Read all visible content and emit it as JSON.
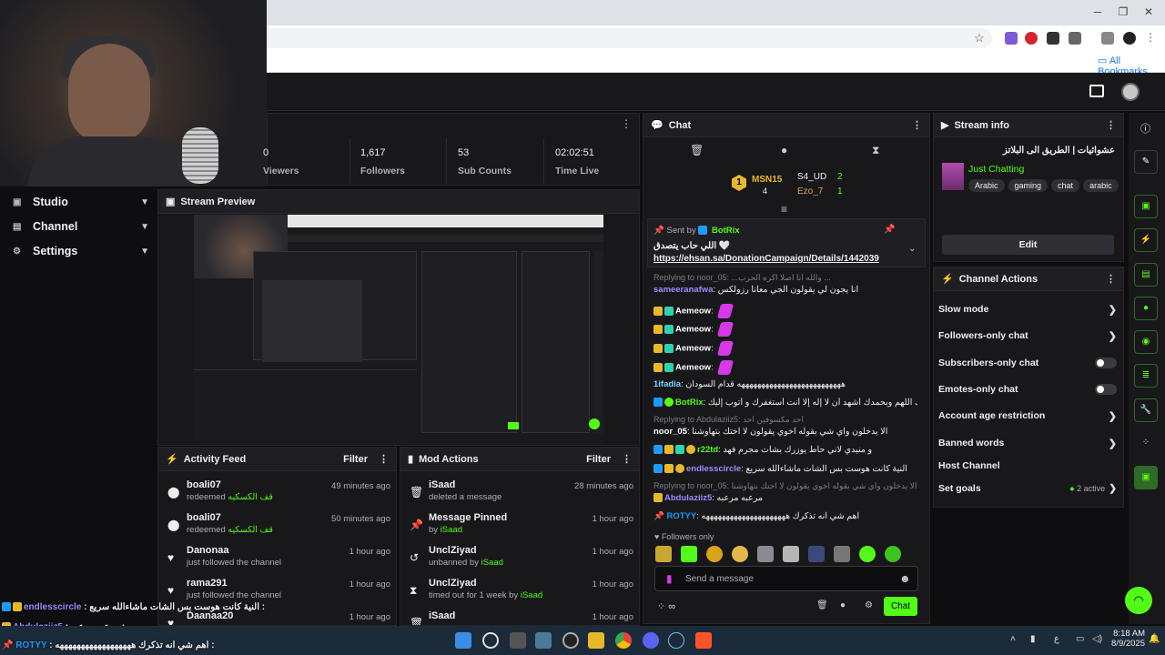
{
  "browser": {
    "all_bookmarks": "All Bookmarks",
    "controls": {
      "minimize": "─",
      "restore": "❐",
      "close": "✕"
    }
  },
  "nav": {
    "items": [
      {
        "label": "Studio",
        "icon": "studio-icon"
      },
      {
        "label": "Channel",
        "icon": "channel-icon"
      },
      {
        "label": "Settings",
        "icon": "gear-icon"
      }
    ]
  },
  "stats": [
    {
      "value": "0",
      "label": "Viewers"
    },
    {
      "value": "1,617",
      "label": "Followers"
    },
    {
      "value": "53",
      "label": "Sub Counts"
    },
    {
      "value": "02:02:51",
      "label": "Time Live"
    }
  ],
  "stream_preview": {
    "title": "Stream Preview"
  },
  "activity_feed": {
    "title": "Activity Feed",
    "filter": "Filter",
    "items": [
      {
        "name": "boali07",
        "action": "redeemed",
        "detail": "قف الكسكيه",
        "time": "49 minutes ago",
        "icon": "redeem-icon"
      },
      {
        "name": "boali07",
        "action": "redeemed",
        "detail": "قف الكسكيه",
        "time": "50 minutes ago",
        "icon": "redeem-icon"
      },
      {
        "name": "Danonaa",
        "action": "just followed the channel",
        "detail": "",
        "time": "1 hour ago",
        "icon": "heart-icon"
      },
      {
        "name": "rama291",
        "action": "just followed the channel",
        "detail": "",
        "time": "1 hour ago",
        "icon": "heart-icon"
      },
      {
        "name": "Daanaa20",
        "action": "",
        "detail": "",
        "time": "1 hour ago",
        "icon": "heart-icon"
      }
    ]
  },
  "mod_actions": {
    "title": "Mod Actions",
    "filter": "Filter",
    "items": [
      {
        "name": "iSaad",
        "action": "deleted a message",
        "by": "",
        "time": "28 minutes ago",
        "icon": "trash-icon"
      },
      {
        "name": "Message Pinned",
        "action": "by",
        "by": "iSaad",
        "time": "1 hour ago",
        "icon": "pin-icon"
      },
      {
        "name": "UnclZiyad",
        "action": "unbanned by",
        "by": "iSaad",
        "time": "1 hour ago",
        "icon": "undo-icon"
      },
      {
        "name": "UnclZiyad",
        "action": "timed out for 1 week by",
        "by": "iSaad",
        "time": "1 hour ago",
        "icon": "hourglass-icon"
      },
      {
        "name": "iSaad",
        "action": "",
        "by": "",
        "time": "1 hour ago",
        "icon": "trash-icon"
      }
    ]
  },
  "chat": {
    "title": "Chat",
    "leaders": [
      {
        "rank": "1",
        "name": "MSN15",
        "count": "4"
      },
      {
        "name": "S4_UD",
        "count": "2"
      },
      {
        "name": "Ezo_7",
        "count": "1"
      }
    ],
    "pinned": {
      "sent_by_label": "Sent by",
      "sent_by": "BotRix",
      "text": "اللي حاب يتصدق 🤍",
      "link": "https://ehsan.sa/DonationCampaign/Details/1442039"
    },
    "messages": [
      {
        "reply": "Replying to noor_05: ...والله انا اصلا اكره الحرب ...",
        "user": "sameeranafwa",
        "text": "انا يجون لي يقولون الجي معانا رزولكس"
      },
      {
        "user": "Aemeow",
        "text": "",
        "emote": true
      },
      {
        "user": "Aemeow",
        "text": "",
        "emote": true
      },
      {
        "user": "Aemeow",
        "text": "",
        "emote": true
      },
      {
        "user": "Aemeow",
        "text": "",
        "emote": true
      },
      {
        "user": "1ifadia",
        "text": "ههههههههههههههههههههههههههه قدام السودان"
      },
      {
        "user": "BotRix",
        "text": "سبحانك اللهم وبحمدك أشهد أن لا إله إلا أنت أستغفرك و أتوب إليك"
      },
      {
        "reply": "Replying to Abdulaziiz5: احد مكسوفين احد",
        "user": "noor_05",
        "text": "الا يدخلون واي شي بقوله اخوي يقولون لا اختك بتهاوشنا"
      },
      {
        "user": "r22td",
        "text": "و منيدي لاني حاط يوزرك بشات مجرم فهد"
      },
      {
        "user": "endlesscircle",
        "text": "النية كانت هوست بس الشات ماشاءالله سريع"
      },
      {
        "reply": "Replying to noor_05: الا يدخلون واي شي بقوله اخوي يقولون لا اختك بتهاوشنا",
        "user": "Abdulaziiz5",
        "text": "مرعبه مرعبه"
      },
      {
        "user": "ROTYY",
        "text": "اهم شي انه تذكرك هههههههههههههههههههههه"
      }
    ],
    "followers_only": "Followers only",
    "input_placeholder": "Send a message",
    "send_label": "Chat"
  },
  "stream_info": {
    "title": "Stream info",
    "stream_title": "عشوائيات | الطريق الى البلاتز",
    "category": "Just Chatting",
    "tags": [
      "Arabic",
      "gaming",
      "chat",
      "arabic"
    ],
    "edit_label": "Edit"
  },
  "channel_actions": {
    "title": "Channel Actions",
    "items": [
      {
        "label": "Slow mode",
        "kind": "chevron"
      },
      {
        "label": "Followers-only chat",
        "kind": "chevron"
      },
      {
        "label": "Subscribers-only chat",
        "kind": "toggle"
      },
      {
        "label": "Emotes-only chat",
        "kind": "toggle"
      },
      {
        "label": "Account age restriction",
        "kind": "chevron"
      },
      {
        "label": "Banned words",
        "kind": "chevron"
      },
      {
        "label": "Host Channel",
        "kind": "none"
      },
      {
        "label": "Set goals",
        "kind": "status",
        "status": "2 active"
      }
    ]
  },
  "overlay_chat": [
    {
      "user": "endlesscircle",
      "text": "النية كانت هوست بس الشات ماشاءالله سريع :"
    },
    {
      "user": "Abdulaziiz5",
      "text": "مرعبه مرعبه :"
    },
    {
      "user": "ROTYY",
      "text": "اهم شي انه تذكرك ههههههههههههههههههه :"
    }
  ],
  "taskbar": {
    "time": "8:18 AM",
    "date": "8/9/2025",
    "lang": "ع"
  },
  "colors": {
    "accent": "#53fc18",
    "panel": "#18181b",
    "background": "#0e0e10",
    "link": "#1b9cfc"
  }
}
